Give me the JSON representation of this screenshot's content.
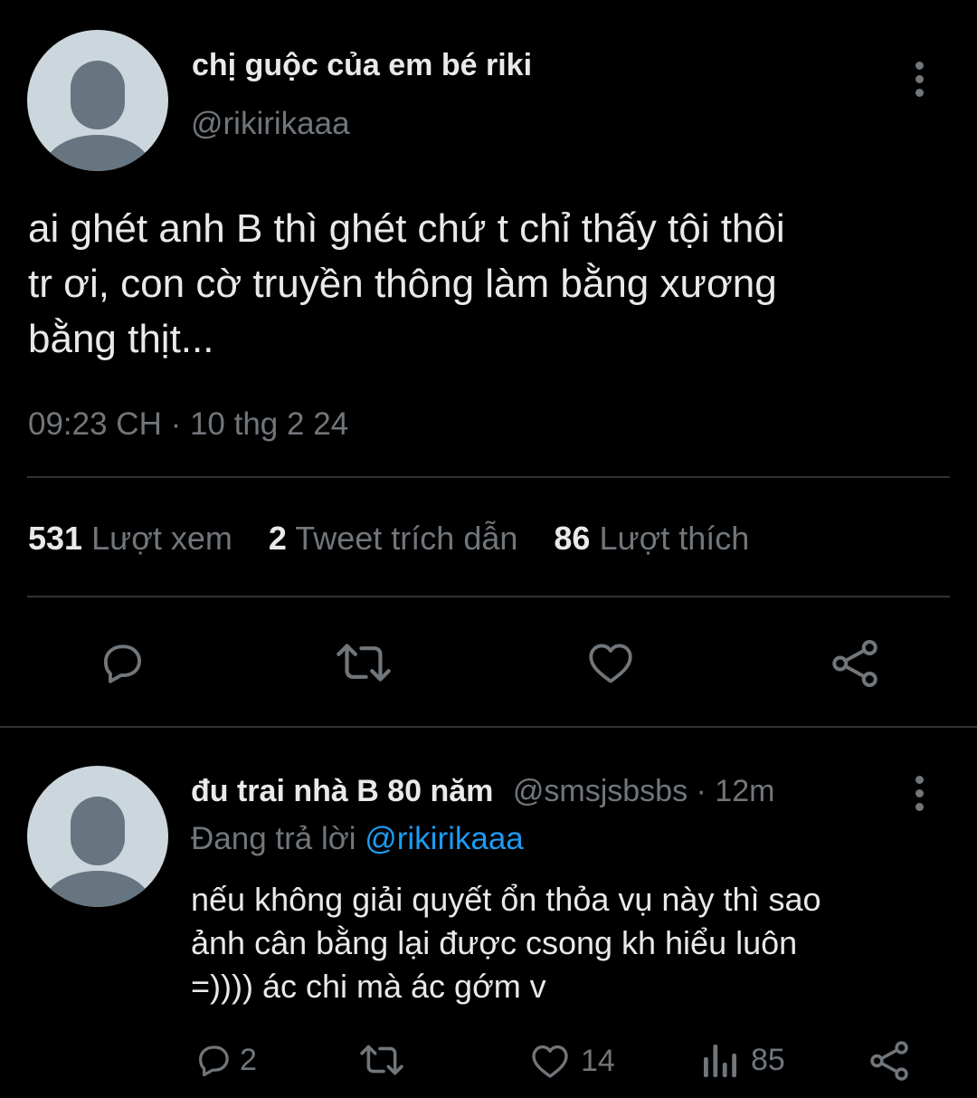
{
  "tweet": {
    "author_name": "chị guộc của em bé riki",
    "author_handle": "@rikirikaaa",
    "text_lines": [
      "ai ghét anh B thì ghét chứ t chỉ thấy tội thôi",
      "tr ơi, con cờ truyền thông làm bằng xương",
      "bằng thịt..."
    ],
    "timestamp": "09:23 CH · 10 thg 2 24",
    "stats": [
      {
        "count": "531",
        "label": "Lượt xem"
      },
      {
        "count": "2",
        "label": "Tweet trích dẫn"
      },
      {
        "count": "86",
        "label": "Lượt thích"
      }
    ],
    "actions": [
      "reply-icon",
      "retweet-icon",
      "like-icon",
      "share-icon"
    ]
  },
  "reply": {
    "author_name": "đu trai nhà B 80 năm",
    "author_handle": "@smsjsbsbs",
    "time": "· 12m",
    "replying_prefix": "Đang trả lời",
    "replying_to": "@rikirikaaa",
    "text_lines": [
      "nếu không giải quyết ổn thỏa vụ này thì sao",
      "ảnh cân bằng lại được csong kh hiểu luôn",
      "=)))) ác chi mà ác gớm v"
    ],
    "reply_count": "2",
    "like_count": "14",
    "view_count": "85"
  },
  "colors": {
    "background": "#000000",
    "text": "#e7e9ea",
    "muted": "#71767b",
    "link": "#1d9bf0",
    "divider": "#2f3336"
  }
}
